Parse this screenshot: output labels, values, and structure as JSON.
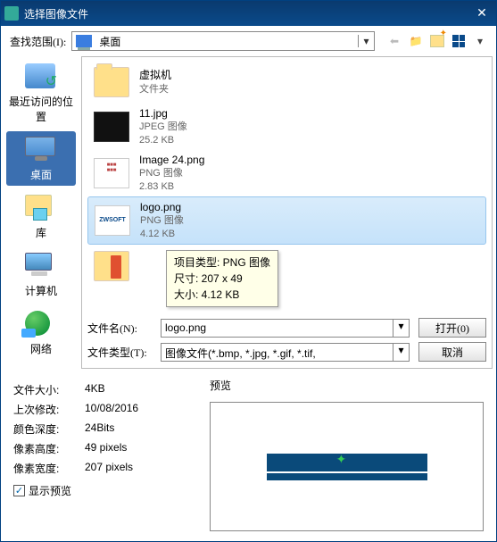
{
  "window": {
    "title": "选择图像文件"
  },
  "toolbar": {
    "lookin_label": "查找范围(I):",
    "location": "桌面",
    "icons": {
      "back": "arrow-left",
      "up": "folder-up",
      "new": "new-folder",
      "view": "view-grid"
    }
  },
  "places": [
    {
      "id": "recent",
      "label": "最近访问的位置"
    },
    {
      "id": "desktop",
      "label": "桌面",
      "selected": true
    },
    {
      "id": "library",
      "label": "库"
    },
    {
      "id": "computer",
      "label": "计算机"
    },
    {
      "id": "network",
      "label": "网络"
    }
  ],
  "files": [
    {
      "name": "虚拟机",
      "type_line": "文件夹",
      "size": "",
      "kind": "folder"
    },
    {
      "name": "11.jpg",
      "type_line": "JPEG 图像",
      "size": "25.2 KB",
      "kind": "jpeg"
    },
    {
      "name": "Image 24.png",
      "type_line": "PNG 图像",
      "size": "2.83 KB",
      "kind": "png-doc"
    },
    {
      "name": "logo.png",
      "type_line": "PNG 图像",
      "size": "4.12 KB",
      "kind": "logo",
      "selected": true
    },
    {
      "name": "",
      "type_line": "",
      "size": "",
      "kind": "folder-col"
    }
  ],
  "tooltip": {
    "line1": "项目类型: PNG 图像",
    "line2": "尺寸: 207 x 49",
    "line3": "大小: 4.12 KB"
  },
  "filename": {
    "label": "文件名(N):",
    "value": "logo.png",
    "open": "打开(0)"
  },
  "filetype": {
    "label": "文件类型(T):",
    "value": "图像文件(*.bmp, *.jpg, *.gif, *.tif,",
    "cancel": "取消"
  },
  "info": {
    "rows": [
      {
        "k": "文件大小:",
        "v": "4KB"
      },
      {
        "k": "上次修改:",
        "v": "10/08/2016"
      },
      {
        "k": "颜色深度:",
        "v": "24Bits"
      },
      {
        "k": "像素高度:",
        "v": "49 pixels"
      },
      {
        "k": "像素宽度:",
        "v": "207 pixels"
      }
    ],
    "show_preview": "显示预览"
  },
  "preview": {
    "header": "预览"
  }
}
